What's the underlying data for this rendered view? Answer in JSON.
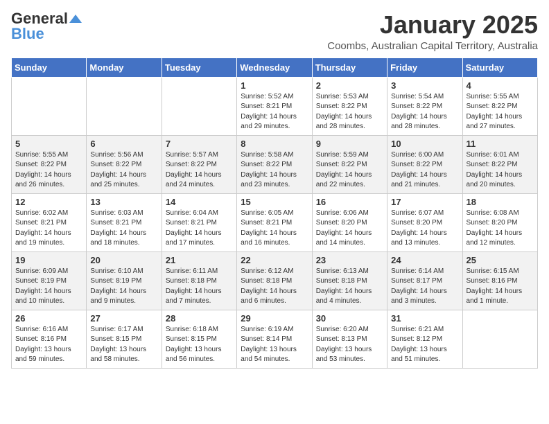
{
  "header": {
    "logo_general": "General",
    "logo_blue": "Blue",
    "month": "January 2025",
    "location": "Coombs, Australian Capital Territory, Australia"
  },
  "weekdays": [
    "Sunday",
    "Monday",
    "Tuesday",
    "Wednesday",
    "Thursday",
    "Friday",
    "Saturday"
  ],
  "weeks": [
    [
      {
        "day": "",
        "info": ""
      },
      {
        "day": "",
        "info": ""
      },
      {
        "day": "",
        "info": ""
      },
      {
        "day": "1",
        "info": "Sunrise: 5:52 AM\nSunset: 8:21 PM\nDaylight: 14 hours\nand 29 minutes."
      },
      {
        "day": "2",
        "info": "Sunrise: 5:53 AM\nSunset: 8:22 PM\nDaylight: 14 hours\nand 28 minutes."
      },
      {
        "day": "3",
        "info": "Sunrise: 5:54 AM\nSunset: 8:22 PM\nDaylight: 14 hours\nand 28 minutes."
      },
      {
        "day": "4",
        "info": "Sunrise: 5:55 AM\nSunset: 8:22 PM\nDaylight: 14 hours\nand 27 minutes."
      }
    ],
    [
      {
        "day": "5",
        "info": "Sunrise: 5:55 AM\nSunset: 8:22 PM\nDaylight: 14 hours\nand 26 minutes."
      },
      {
        "day": "6",
        "info": "Sunrise: 5:56 AM\nSunset: 8:22 PM\nDaylight: 14 hours\nand 25 minutes."
      },
      {
        "day": "7",
        "info": "Sunrise: 5:57 AM\nSunset: 8:22 PM\nDaylight: 14 hours\nand 24 minutes."
      },
      {
        "day": "8",
        "info": "Sunrise: 5:58 AM\nSunset: 8:22 PM\nDaylight: 14 hours\nand 23 minutes."
      },
      {
        "day": "9",
        "info": "Sunrise: 5:59 AM\nSunset: 8:22 PM\nDaylight: 14 hours\nand 22 minutes."
      },
      {
        "day": "10",
        "info": "Sunrise: 6:00 AM\nSunset: 8:22 PM\nDaylight: 14 hours\nand 21 minutes."
      },
      {
        "day": "11",
        "info": "Sunrise: 6:01 AM\nSunset: 8:22 PM\nDaylight: 14 hours\nand 20 minutes."
      }
    ],
    [
      {
        "day": "12",
        "info": "Sunrise: 6:02 AM\nSunset: 8:21 PM\nDaylight: 14 hours\nand 19 minutes."
      },
      {
        "day": "13",
        "info": "Sunrise: 6:03 AM\nSunset: 8:21 PM\nDaylight: 14 hours\nand 18 minutes."
      },
      {
        "day": "14",
        "info": "Sunrise: 6:04 AM\nSunset: 8:21 PM\nDaylight: 14 hours\nand 17 minutes."
      },
      {
        "day": "15",
        "info": "Sunrise: 6:05 AM\nSunset: 8:21 PM\nDaylight: 14 hours\nand 16 minutes."
      },
      {
        "day": "16",
        "info": "Sunrise: 6:06 AM\nSunset: 8:20 PM\nDaylight: 14 hours\nand 14 minutes."
      },
      {
        "day": "17",
        "info": "Sunrise: 6:07 AM\nSunset: 8:20 PM\nDaylight: 14 hours\nand 13 minutes."
      },
      {
        "day": "18",
        "info": "Sunrise: 6:08 AM\nSunset: 8:20 PM\nDaylight: 14 hours\nand 12 minutes."
      }
    ],
    [
      {
        "day": "19",
        "info": "Sunrise: 6:09 AM\nSunset: 8:19 PM\nDaylight: 14 hours\nand 10 minutes."
      },
      {
        "day": "20",
        "info": "Sunrise: 6:10 AM\nSunset: 8:19 PM\nDaylight: 14 hours\nand 9 minutes."
      },
      {
        "day": "21",
        "info": "Sunrise: 6:11 AM\nSunset: 8:18 PM\nDaylight: 14 hours\nand 7 minutes."
      },
      {
        "day": "22",
        "info": "Sunrise: 6:12 AM\nSunset: 8:18 PM\nDaylight: 14 hours\nand 6 minutes."
      },
      {
        "day": "23",
        "info": "Sunrise: 6:13 AM\nSunset: 8:18 PM\nDaylight: 14 hours\nand 4 minutes."
      },
      {
        "day": "24",
        "info": "Sunrise: 6:14 AM\nSunset: 8:17 PM\nDaylight: 14 hours\nand 3 minutes."
      },
      {
        "day": "25",
        "info": "Sunrise: 6:15 AM\nSunset: 8:16 PM\nDaylight: 14 hours\nand 1 minute."
      }
    ],
    [
      {
        "day": "26",
        "info": "Sunrise: 6:16 AM\nSunset: 8:16 PM\nDaylight: 13 hours\nand 59 minutes."
      },
      {
        "day": "27",
        "info": "Sunrise: 6:17 AM\nSunset: 8:15 PM\nDaylight: 13 hours\nand 58 minutes."
      },
      {
        "day": "28",
        "info": "Sunrise: 6:18 AM\nSunset: 8:15 PM\nDaylight: 13 hours\nand 56 minutes."
      },
      {
        "day": "29",
        "info": "Sunrise: 6:19 AM\nSunset: 8:14 PM\nDaylight: 13 hours\nand 54 minutes."
      },
      {
        "day": "30",
        "info": "Sunrise: 6:20 AM\nSunset: 8:13 PM\nDaylight: 13 hours\nand 53 minutes."
      },
      {
        "day": "31",
        "info": "Sunrise: 6:21 AM\nSunset: 8:12 PM\nDaylight: 13 hours\nand 51 minutes."
      },
      {
        "day": "",
        "info": ""
      }
    ]
  ]
}
